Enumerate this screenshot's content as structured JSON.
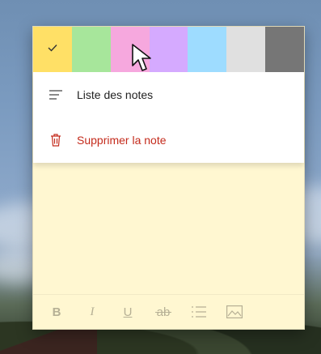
{
  "colors": {
    "swatches": [
      "#ffe066",
      "#a7e69b",
      "#f6a8de",
      "#d5aaff",
      "#9edcff",
      "#e0e0e0",
      "#767676"
    ],
    "delete_red": "#c42b1c",
    "note_background": "#fff7d1"
  },
  "swatch_names": [
    "Jaune",
    "Vert",
    "Rose",
    "Violet",
    "Bleu",
    "Gris",
    "Anthracite"
  ],
  "selected_swatch": "Jaune",
  "menu": {
    "list_notes": "Liste des notes",
    "delete_note": "Supprimer la note"
  },
  "toolbar": {
    "bold": "B",
    "italic": "I",
    "underline": "U",
    "strikethrough": "ab",
    "icons": [
      "bold-icon",
      "italic-icon",
      "underline-icon",
      "strikethrough-icon",
      "bullet-list-icon",
      "image-icon"
    ]
  }
}
